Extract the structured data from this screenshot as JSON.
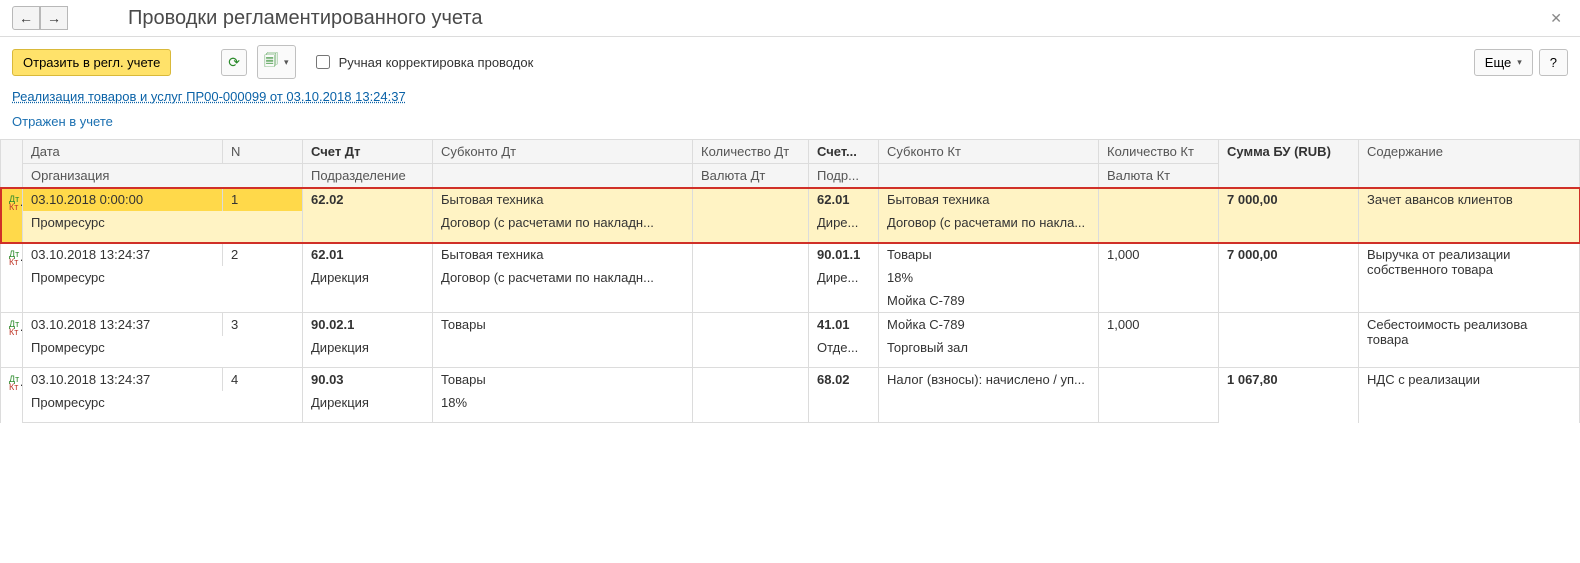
{
  "header": {
    "title": "Проводки регламентированного учета"
  },
  "toolbar": {
    "reflect_button": "Отразить в регл. учете",
    "manual_checkbox_label": "Ручная корректировка проводок",
    "more_button": "Еще",
    "help_button": "?"
  },
  "doc_link": "Реализация товаров и услуг ПР00-000099 от 03.10.2018 13:24:37",
  "status_text": "Отражен в учете",
  "columns": {
    "r1": {
      "date": "Дата",
      "n": "N",
      "acct_dt": "Счет Дт",
      "sub_dt": "Субконто Дт",
      "qty_dt": "Количество Дт",
      "acct_kt": "Счет...",
      "sub_kt": "Субконто Кт",
      "qty_kt": "Количество Кт",
      "sum": "Сумма БУ (RUB)",
      "desc": "Содержание"
    },
    "r2": {
      "org": "Организация",
      "dept": "Подразделение",
      "cur_dt": "Валюта Дт",
      "dept_kt": "Подр...",
      "cur_kt": "Валюта Кт"
    }
  },
  "rows": [
    {
      "highlight": true,
      "date": "03.10.2018 0:00:00",
      "n": "1",
      "org": "Промресурс",
      "acct_dt": "62.02",
      "dept_dt": "",
      "sub_dt": [
        "Бытовая техника",
        "Договор (с расчетами по накладн...",
        ""
      ],
      "qty_dt": "",
      "cur_dt": "",
      "acct_kt": "62.01",
      "dept_kt": "Дире...",
      "sub_kt": [
        "Бытовая техника",
        "Договор (с расчетами по накла...",
        ""
      ],
      "qty_kt": "",
      "cur_kt": "",
      "sum": "7 000,00",
      "desc": "Зачет авансов клиентов"
    },
    {
      "highlight": false,
      "date": "03.10.2018 13:24:37",
      "n": "2",
      "org": "Промресурс",
      "acct_dt": "62.01",
      "dept_dt": "Дирекция",
      "sub_dt": [
        "Бытовая техника",
        "Договор (с расчетами по накладн...",
        ""
      ],
      "qty_dt": "",
      "cur_dt": "",
      "acct_kt": "90.01.1",
      "dept_kt": "Дире...",
      "sub_kt": [
        "Товары",
        "18%",
        "Мойка С-789"
      ],
      "qty_kt": "1,000",
      "cur_kt": "",
      "sum": "7 000,00",
      "desc": "Выручка от реализации собственного товара"
    },
    {
      "highlight": false,
      "date": "03.10.2018 13:24:37",
      "n": "3",
      "org": "Промресурс",
      "acct_dt": "90.02.1",
      "dept_dt": "Дирекция",
      "sub_dt": [
        "Товары",
        "",
        ""
      ],
      "qty_dt": "",
      "cur_dt": "",
      "acct_kt": "41.01",
      "dept_kt": "Отде...",
      "sub_kt": [
        "Мойка С-789",
        "Торговый зал",
        ""
      ],
      "qty_kt": "1,000",
      "cur_kt": "",
      "sum": "",
      "desc": "Себестоимость реализова товара"
    },
    {
      "highlight": false,
      "date": "03.10.2018 13:24:37",
      "n": "4",
      "org": "Промресурс",
      "acct_dt": "90.03",
      "dept_dt": "Дирекция",
      "sub_dt": [
        "Товары",
        "18%",
        ""
      ],
      "qty_dt": "",
      "cur_dt": "",
      "acct_kt": "68.02",
      "dept_kt": "",
      "sub_kt": [
        "Налог (взносы): начислено / уп...",
        "",
        ""
      ],
      "qty_kt": "",
      "cur_kt": "",
      "sum": "1 067,80",
      "desc": "НДС с реализации"
    }
  ]
}
